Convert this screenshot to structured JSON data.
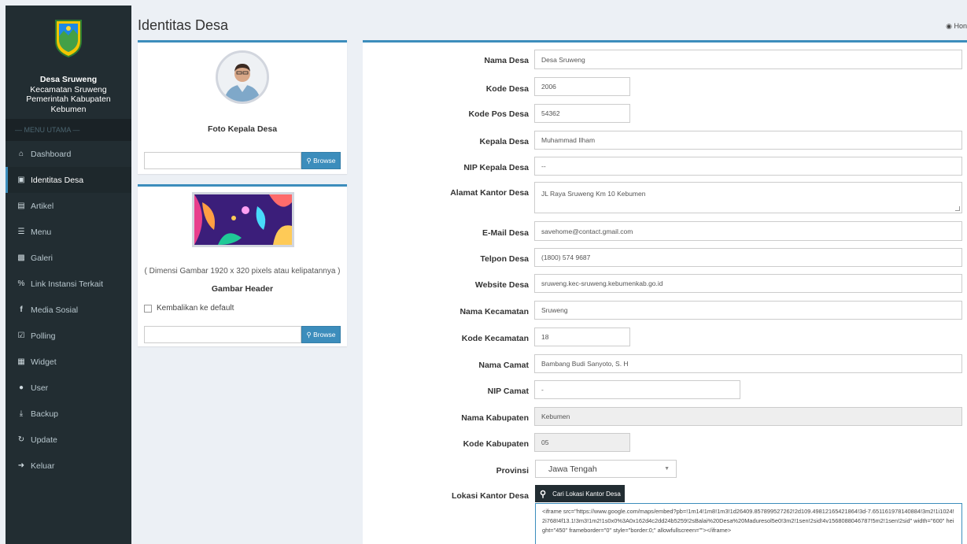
{
  "sidebar": {
    "org_name": "Desa Sruweng",
    "org_sub1": "Kecamatan Sruweng",
    "org_sub2": "Pemerintah Kabupaten Kebumen",
    "menu_header": "— MENU UTAMA —",
    "items": [
      {
        "label": "Dashboard",
        "icon": "home-icon"
      },
      {
        "label": "Identitas Desa",
        "icon": "id-card-icon"
      },
      {
        "label": "Artikel",
        "icon": "file-icon"
      },
      {
        "label": "Menu",
        "icon": "bars-icon"
      },
      {
        "label": "Galeri",
        "icon": "image-icon"
      },
      {
        "label": "Link Instansi Terkait",
        "icon": "link-icon"
      },
      {
        "label": "Media Sosial",
        "icon": "facebook-icon"
      },
      {
        "label": "Polling",
        "icon": "check-square-icon"
      },
      {
        "label": "Widget",
        "icon": "grid-icon"
      },
      {
        "label": "User",
        "icon": "user-icon"
      },
      {
        "label": "Backup",
        "icon": "download-icon"
      },
      {
        "label": "Update",
        "icon": "refresh-icon"
      },
      {
        "label": "Keluar",
        "icon": "sign-out-icon"
      }
    ]
  },
  "header": {
    "title": "Identitas Desa",
    "breadcrumb": "Hon"
  },
  "photo_box": {
    "caption": "Foto Kepala Desa",
    "browse_label": "Browse"
  },
  "header_box": {
    "dimension_note": "( Dimensi Gambar 1920 x 320 pixels atau kelipatannya )",
    "caption": "Gambar Header",
    "reset_label": "Kembalikan ke default",
    "browse_label": "Browse"
  },
  "form": {
    "nama_desa": {
      "label": "Nama Desa",
      "value": "Desa Sruweng"
    },
    "kode_desa": {
      "label": "Kode Desa",
      "value": "2006"
    },
    "kode_pos": {
      "label": "Kode Pos Desa",
      "value": "54362"
    },
    "kepala_desa": {
      "label": "Kepala Desa",
      "value": "Muhammad Ilham"
    },
    "nip_kepala": {
      "label": "NIP Kepala Desa",
      "value": "--"
    },
    "alamat": {
      "label": "Alamat Kantor Desa",
      "value": "JL Raya Sruweng Km 10 Kebumen"
    },
    "email": {
      "label": "E-Mail Desa",
      "value": "savehome@contact.gmail.com"
    },
    "telpon": {
      "label": "Telpon Desa",
      "value": "(1800) 574 9687"
    },
    "website": {
      "label": "Website Desa",
      "value": "sruweng.kec-sruweng.kebumenkab.go.id"
    },
    "nama_kecamatan": {
      "label": "Nama Kecamatan",
      "value": "Sruweng"
    },
    "kode_kecamatan": {
      "label": "Kode Kecamatan",
      "value": "18"
    },
    "nama_camat": {
      "label": "Nama Camat",
      "value": "Bambang Budi Sanyoto, S. H"
    },
    "nip_camat": {
      "label": "NIP Camat",
      "value": "-"
    },
    "nama_kabupaten": {
      "label": "Nama Kabupaten",
      "value": "Kebumen"
    },
    "kode_kabupaten": {
      "label": "Kode Kabupaten",
      "value": "05"
    },
    "provinsi": {
      "label": "Provinsi",
      "value": "Jawa Tengah"
    },
    "lokasi": {
      "label": "Lokasi Kantor Desa",
      "button_label": "Cari Lokasi Kantor Desa",
      "value": "<iframe src=\"https://www.google.com/maps/embed?pb=!1m14!1m8!1m3!1d26409.857899527262!2d109.49812165421864!3d-7.651161978140884!3m2!1i1024!2i768!4f13.1!3m3!1m2!1s0x0%3A0x162d4c2dd24b5259!2sBalai%20Desa%20Maduresol5e0!3m2!1sen!2sid!4v1568088046787!5m2!1sen!2sid\" width=\"600\" height=\"450\" frameborder=\"0\" style=\"border:0;\" allowfullscreen=\"\"></iframe>"
    }
  },
  "colors": {
    "sidebar_bg": "#222d32",
    "accent": "#3c8dbc",
    "content_bg": "#ecf0f5"
  }
}
